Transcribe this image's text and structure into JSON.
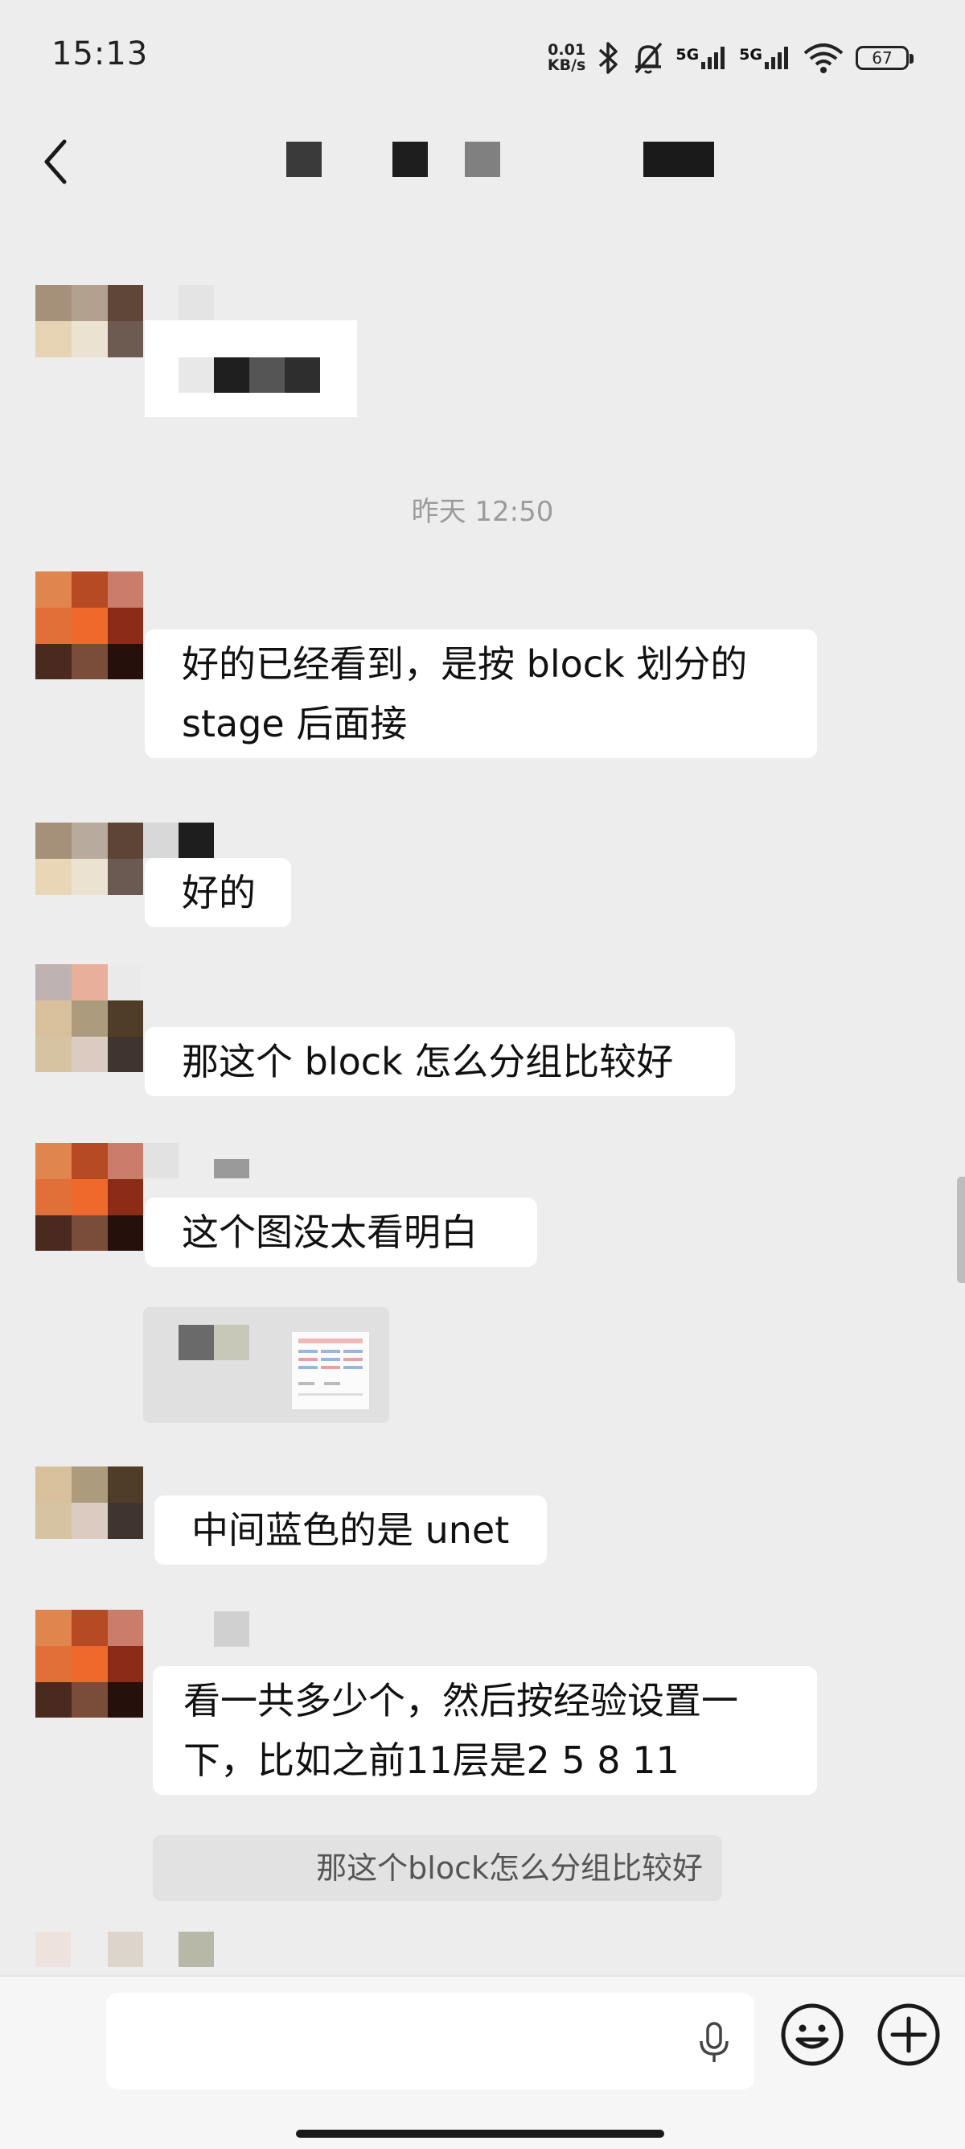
{
  "status_bar": {
    "time": "15:13",
    "net_speed_value": "0.01",
    "net_speed_unit": "KB/s",
    "network_1": "5G",
    "network_2": "5G",
    "battery": "67",
    "icons": [
      "bluetooth-icon",
      "mute-bell-icon",
      "signal-icon",
      "signal-icon",
      "wifi-icon",
      "battery-icon"
    ]
  },
  "header": {
    "back_icon": "chevron-left-icon"
  },
  "chat": {
    "timestamp": "昨天 12:50",
    "messages": [
      {
        "text": "好的已经看到，是按 block 划分的\nstage 后面接"
      },
      {
        "text": "好的"
      },
      {
        "text": "那这个 block 怎么分组比较好"
      },
      {
        "text": "这个图没太看明白"
      },
      {
        "text": "中间蓝色的是 unet"
      },
      {
        "text": "看一共多少个，然后按经验设置一\n下，比如之前11层是2 5 8 11"
      }
    ],
    "quote": "那这个block怎么分组比较好"
  },
  "input_bar": {
    "mic_icon": "microphone-icon",
    "emoji_icon": "smiley-icon",
    "add_icon": "plus-circle-icon"
  },
  "colors": {
    "background": "#ededed",
    "bubble": "#ffffff",
    "quote": "#e2e2e2",
    "timestamp_text": "#9b9b9b"
  }
}
